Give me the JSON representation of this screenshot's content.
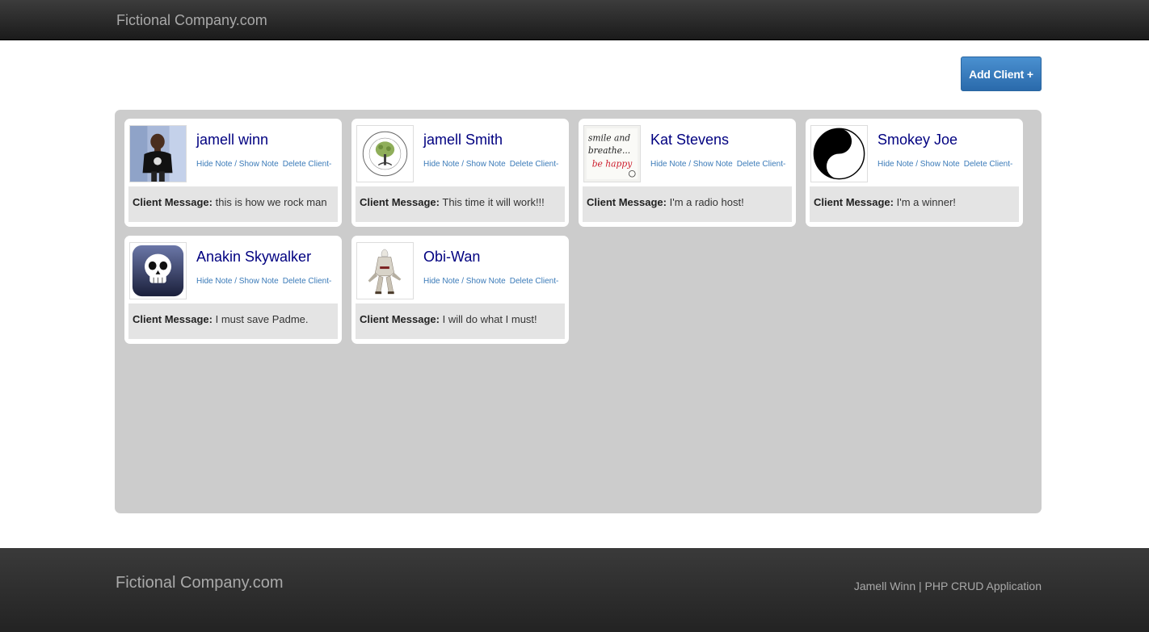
{
  "navbar": {
    "brand": "Fictional Company.com"
  },
  "toolbar": {
    "add_client_label": "Add Client +"
  },
  "clients": [
    {
      "name": "jamell winn",
      "hide_show": "Hide Note / Show Note",
      "delete": "Delete Client-",
      "message_label": "Client Message:",
      "message": "this is how we rock man",
      "avatar": "child-photo-icon"
    },
    {
      "name": "jamell Smith",
      "hide_show": "Hide Note / Show Note",
      "delete": "Delete Client-",
      "message_label": "Client Message:",
      "message": "This time it will work!!!",
      "avatar": "tree-emblem-icon"
    },
    {
      "name": "Kat Stevens",
      "hide_show": "Hide Note / Show Note",
      "delete": "Delete Client-",
      "message_label": "Client Message:",
      "message": "I'm a radio host!",
      "avatar": "smile-breathe-icon",
      "avatar_text": [
        "smile and",
        "breathe...",
        "be happy"
      ]
    },
    {
      "name": "Smokey Joe",
      "hide_show": "Hide Note / Show Note",
      "delete": "Delete Client-",
      "message_label": "Client Message:",
      "message": "I'm a winner!",
      "avatar": "yin-yang-icon"
    },
    {
      "name": "Anakin Skywalker",
      "hide_show": "Hide Note / Show Note",
      "delete": "Delete Client-",
      "message_label": "Client Message:",
      "message": "I must save Padme.",
      "avatar": "skull-icon"
    },
    {
      "name": "Obi-Wan",
      "hide_show": "Hide Note / Show Note",
      "delete": "Delete Client-",
      "message_label": "Client Message:",
      "message": "I will do what I must!",
      "avatar": "assassin-figure-icon"
    }
  ],
  "footer": {
    "brand": "Fictional Company.com",
    "credit": "Jamell Winn | PHP CRUD Application"
  },
  "colors": {
    "accent": "#2f74b5",
    "name": "#000080",
    "link": "#3a7ab8",
    "panel": "#cccccc"
  }
}
